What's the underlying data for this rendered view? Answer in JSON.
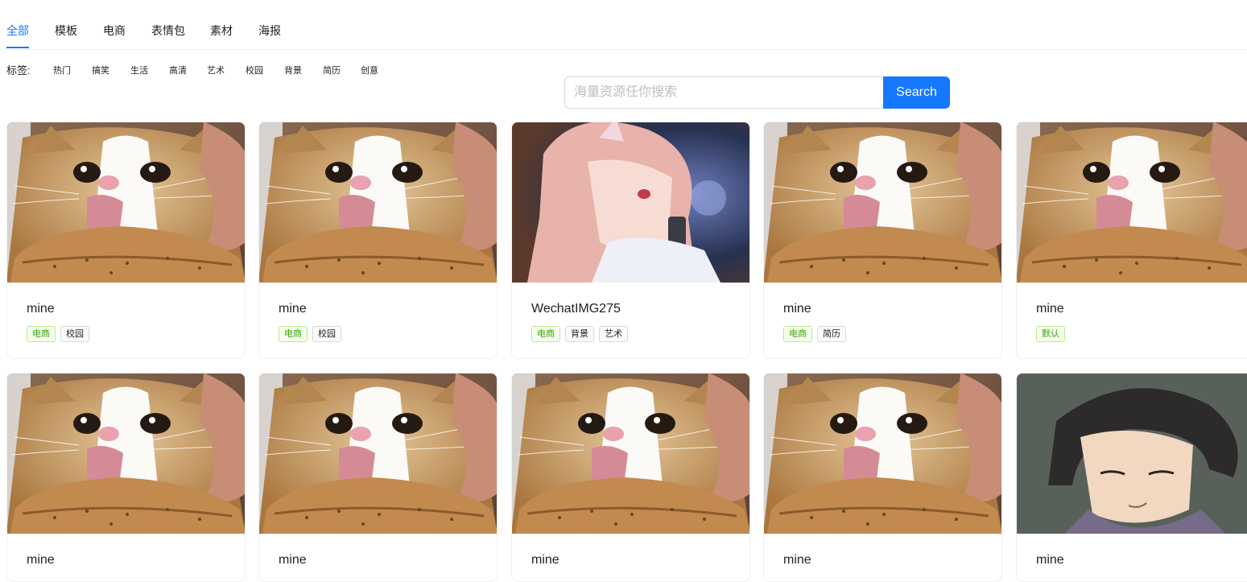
{
  "tabs": [
    "全部",
    "模板",
    "电商",
    "表情包",
    "素材",
    "海报"
  ],
  "active_tab": "全部",
  "tags": {
    "label": "标签:",
    "items": [
      "热门",
      "搞笑",
      "生活",
      "高清",
      "艺术",
      "校园",
      "背景",
      "简历",
      "创意"
    ]
  },
  "search": {
    "placeholder": "海量资源任你搜索",
    "value": "",
    "button_label": "Search"
  },
  "cards": [
    {
      "title": "mine",
      "image": "cat-with-bread",
      "tags": [
        "电商",
        "校园"
      ]
    },
    {
      "title": "mine",
      "image": "cat-with-bread",
      "tags": [
        "电商",
        "校园"
      ]
    },
    {
      "title": "WechatIMG275",
      "image": "anime-girl",
      "tags": [
        "电商",
        "背景",
        "艺术"
      ]
    },
    {
      "title": "mine",
      "image": "cat-with-bread",
      "tags": [
        "电商",
        "简历"
      ]
    },
    {
      "title": "mine",
      "image": "cat-with-bread",
      "tags": [
        "默认"
      ]
    },
    {
      "title": "mine",
      "image": "cat-with-bread",
      "tags": []
    },
    {
      "title": "mine",
      "image": "cat-with-bread",
      "tags": []
    },
    {
      "title": "mine",
      "image": "cat-with-bread",
      "tags": []
    },
    {
      "title": "mine",
      "image": "cat-with-bread",
      "tags": []
    },
    {
      "title": "mine",
      "image": "anime-boy",
      "tags": []
    }
  ],
  "colors": {
    "primary": "#1677ff",
    "category_tag_text": "#389e0d",
    "category_tag_bg": "#f6ffed",
    "category_tag_border": "#b7eb8f"
  }
}
